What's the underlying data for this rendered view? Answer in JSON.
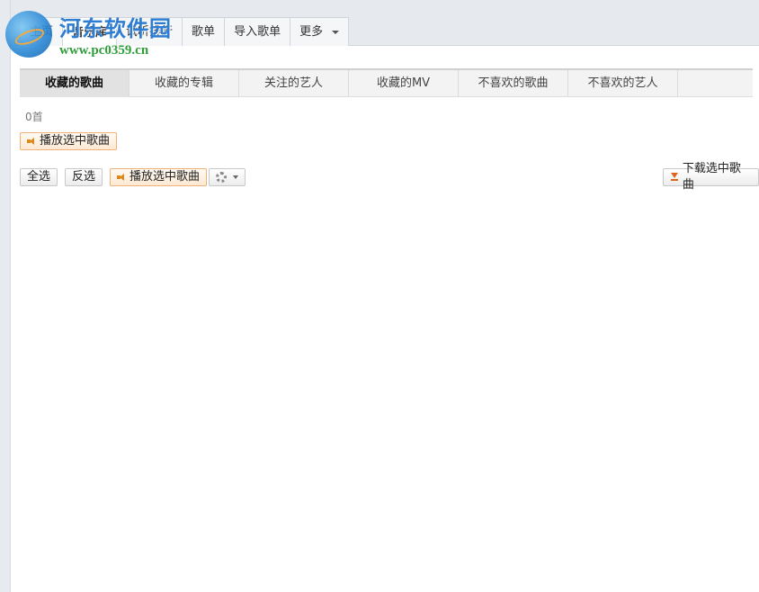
{
  "logo": {
    "text": "河东软件园",
    "url": "www.pc0359.cn"
  },
  "nav": {
    "tabs": [
      {
        "label": "主页"
      },
      {
        "label": "音乐库"
      },
      {
        "label": "试听排行"
      },
      {
        "label": "歌单"
      },
      {
        "label": "导入歌单"
      },
      {
        "label": "更多"
      }
    ]
  },
  "subtabs": [
    {
      "label": "收藏的歌曲"
    },
    {
      "label": "收藏的专辑"
    },
    {
      "label": "关注的艺人"
    },
    {
      "label": "收藏的MV"
    },
    {
      "label": "不喜欢的歌曲"
    },
    {
      "label": "不喜欢的艺人"
    }
  ],
  "list": {
    "count": "0首"
  },
  "buttons": {
    "play_selected_top": "播放选中歌曲",
    "select_all": "全选",
    "invert": "反选",
    "play_selected": "播放选中歌曲",
    "download_selected": "下载选中歌曲"
  },
  "colors": {
    "accent_orange": "#f0b27a",
    "logo_blue": "#2e7dd2",
    "logo_green": "#2f9d3a"
  },
  "icons": [
    "speaker-icon",
    "gear-icon",
    "download-icon",
    "chevron-down-icon"
  ]
}
